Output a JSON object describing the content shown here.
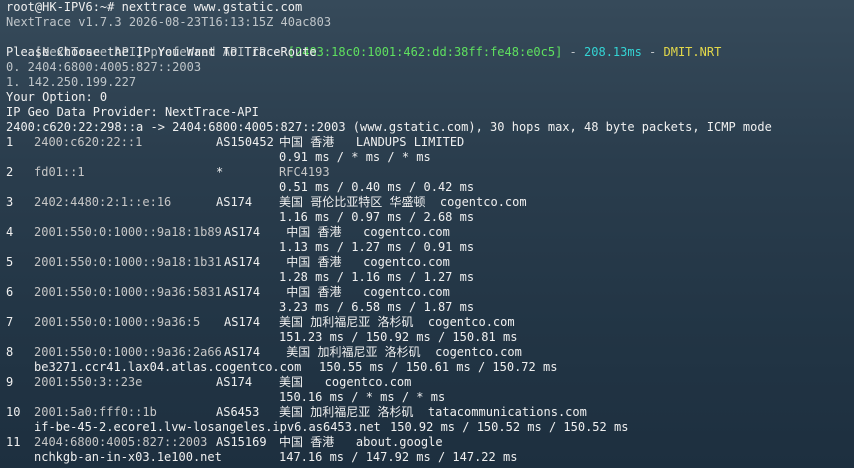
{
  "header": {
    "prompt": "root@HK-IPV6:~# nexttrace www.gstatic.com",
    "version": "NextTrace v1.7.3 2026-08-23T16:13:15Z 40ac803",
    "api_prefix": "[NextTrace API] preferred API IP - ",
    "api_ip": "[2403:18c0:1001:462:dd:38ff:fe48:e0c5]",
    "api_sep1": " - ",
    "api_latency": "208.13ms",
    "api_sep2": " - ",
    "api_node": "DMIT.NRT",
    "choose": "Please Choose the IP You Want To TraceRoute",
    "option0": "0. 2404:6800:4005:827::2003",
    "option1": "1. 142.250.199.227",
    "your_option": "Your Option: 0",
    "geo_provider": "IP Geo Data Provider: NextTrace-API",
    "trace_info": "2400:c620:22:298::a -> 2404:6800:4005:827::2003 (www.gstatic.com), 30 hops max, 48 byte packets, ICMP mode"
  },
  "hops": [
    {
      "num": "1",
      "ip": "2400:c620:22::1",
      "asn": "AS150452",
      "geo": "中国 香港   LANDUPS LIMITED",
      "rtt": "0.91 ms / * ms / * ms"
    },
    {
      "num": "2",
      "ip": "fd01::1",
      "asn": "*",
      "geo": "RFC4193",
      "rtt": "0.51 ms / 0.40 ms / 0.42 ms"
    },
    {
      "num": "3",
      "ip": "2402:4480:2:1::e:16",
      "asn": "AS174",
      "geo": "美国 哥伦比亚特区 华盛顿  cogentco.com",
      "rtt": "1.16 ms / 0.97 ms / 2.68 ms"
    },
    {
      "num": "4",
      "ip": "2001:550:0:1000::9a18:1b89",
      "asn": "AS174",
      "geo": " 中国 香港   cogentco.com",
      "rtt": "1.13 ms / 1.27 ms / 0.91 ms"
    },
    {
      "num": "5",
      "ip": "2001:550:0:1000::9a18:1b31",
      "asn": "AS174",
      "geo": " 中国 香港   cogentco.com",
      "rtt": "1.28 ms / 1.16 ms / 1.27 ms"
    },
    {
      "num": "6",
      "ip": "2001:550:0:1000::9a36:5831",
      "asn": "AS174",
      "geo": " 中国 香港   cogentco.com",
      "rtt": "3.23 ms / 6.58 ms / 1.87 ms"
    },
    {
      "num": "7",
      "ip": "2001:550:0:1000::9a36:5",
      "asn": "AS174",
      "geo": "美国 加利福尼亚 洛杉矶  cogentco.com",
      "rtt": "151.23 ms / 150.92 ms / 150.81 ms"
    },
    {
      "num": "8",
      "ip": "2001:550:0:1000::9a36:2a66",
      "asn": "AS174",
      "geo": " 美国 加利福尼亚 洛杉矶  cogentco.com",
      "host": "be3271.ccr41.lax04.atlas.cogentco.com",
      "rtt": "150.55 ms / 150.61 ms / 150.72 ms"
    },
    {
      "num": "9",
      "ip": "2001:550:3::23e",
      "asn": "AS174",
      "geo": "美国   cogentco.com",
      "rtt": "150.16 ms / * ms / * ms"
    },
    {
      "num": "10",
      "ip": "2001:5a0:fff0::1b",
      "asn": "AS6453",
      "geo": "美国 加利福尼亚 洛杉矶  tatacommunications.com",
      "host": "if-be-45-2.ecore1.lvw-losangeles.ipv6.as6453.net",
      "rtt": "150.92 ms / 150.52 ms / 150.52 ms"
    },
    {
      "num": "11",
      "ip": "2404:6800:4005:827::2003",
      "asn": "AS15169",
      "geo": "中国 香港   about.google",
      "host": "nchkgb-an-in-x03.1e100.net",
      "rtt": "147.16 ms / 147.92 ms / 147.22 ms"
    }
  ],
  "colors": {
    "background_top": "#364a5a",
    "background_bottom": "#1d2f3f",
    "api_ip": "#5fe05f",
    "api_latency": "#34d4d4",
    "api_node": "#e3d84a"
  }
}
